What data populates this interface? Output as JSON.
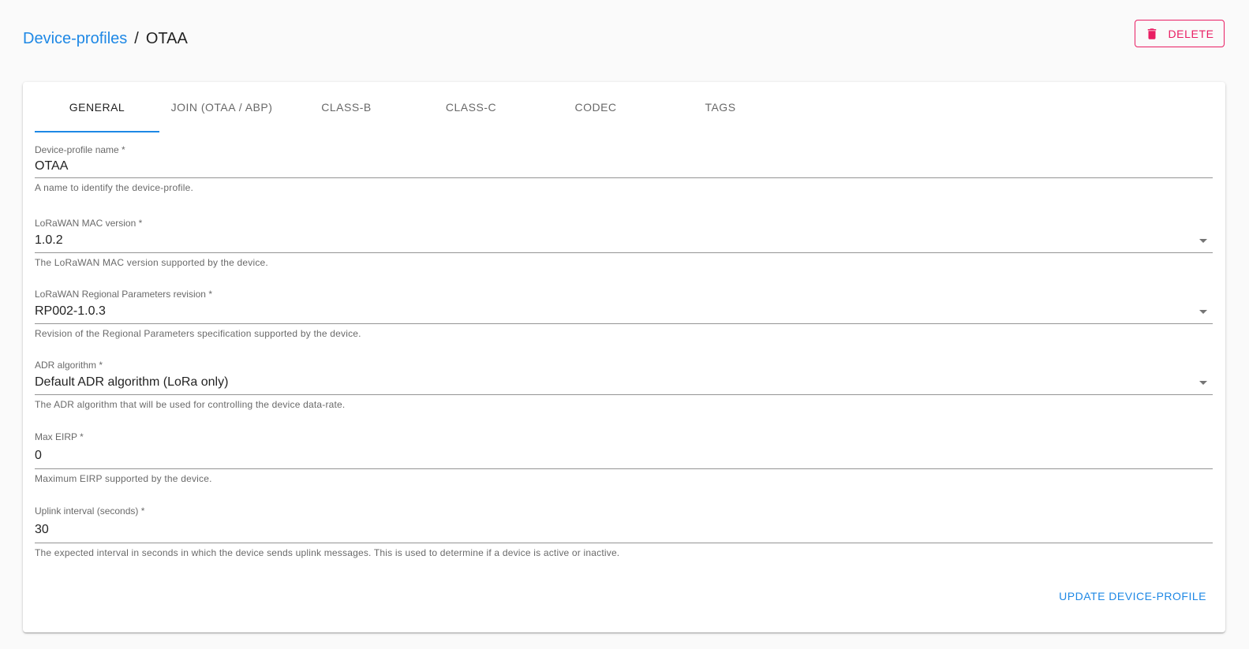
{
  "breadcrumb": {
    "parent": "Device-profiles",
    "separator": "/",
    "current": "OTAA"
  },
  "actions": {
    "delete_label": "DELETE",
    "delete_icon": "trash-icon",
    "update_label": "UPDATE DEVICE-PROFILE"
  },
  "colors": {
    "accent": "#1e88e5",
    "danger": "#e91e63"
  },
  "tabs": [
    {
      "label": "GENERAL",
      "active": true
    },
    {
      "label": "JOIN (OTAA / ABP)",
      "active": false
    },
    {
      "label": "CLASS-B",
      "active": false
    },
    {
      "label": "CLASS-C",
      "active": false
    },
    {
      "label": "CODEC",
      "active": false
    },
    {
      "label": "TAGS",
      "active": false
    }
  ],
  "fields": {
    "name": {
      "label": "Device-profile name *",
      "value": "OTAA",
      "help": "A name to identify the device-profile."
    },
    "mac_version": {
      "label": "LoRaWAN MAC version *",
      "value": "1.0.2",
      "help": "The LoRaWAN MAC version supported by the device."
    },
    "regional_params": {
      "label": "LoRaWAN Regional Parameters revision *",
      "value": "RP002-1.0.3",
      "help": "Revision of the Regional Parameters specification supported by the device."
    },
    "adr_algorithm": {
      "label": "ADR algorithm *",
      "value": "Default ADR algorithm (LoRa only)",
      "help": "The ADR algorithm that will be used for controlling the device data-rate."
    },
    "max_eirp": {
      "label": "Max EIRP *",
      "value": "0",
      "help": "Maximum EIRP supported by the device."
    },
    "uplink_interval": {
      "label": "Uplink interval (seconds) *",
      "value": "30",
      "help": "The expected interval in seconds in which the device sends uplink messages. This is used to determine if a device is active or inactive."
    }
  }
}
